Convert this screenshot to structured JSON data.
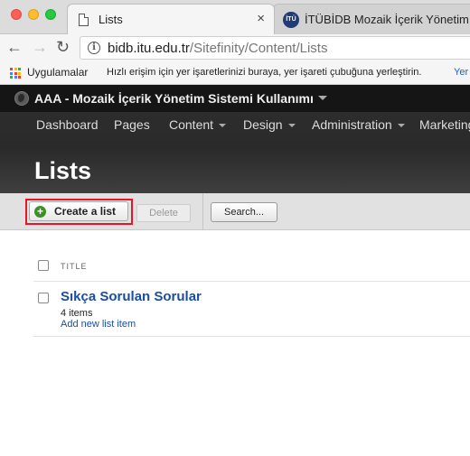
{
  "browser": {
    "tabs": [
      {
        "title": "Lists",
        "active": true
      },
      {
        "title": "İTÜBİDB Mozaik İçerik Yönetim",
        "active": false,
        "icon_text": "İTÜ"
      }
    ],
    "close_glyph": "×",
    "url_host": "bidb.itu.edu.tr",
    "url_path": "/Sitefinity/Content/Lists",
    "bookmarks": {
      "apps_label": "Uygulamalar",
      "hint": "Hızlı erişim için yer işaretlerinizi buraya, yer işareti çubuğuna yerleştirin.",
      "overflow": "Yer"
    }
  },
  "cms": {
    "site_name": "AAA - Mozaik İçerik Yönetim Sistemi Kullanımı",
    "nav": [
      {
        "label": "Dashboard",
        "dropdown": false
      },
      {
        "label": "Pages",
        "dropdown": false
      },
      {
        "label": "Content",
        "dropdown": true
      },
      {
        "label": "Design",
        "dropdown": true
      },
      {
        "label": "Administration",
        "dropdown": true
      },
      {
        "label": "Marketing",
        "dropdown": false
      }
    ],
    "page_title": "Lists"
  },
  "toolbar": {
    "create_label": "Create a list",
    "delete_label": "Delete",
    "search_label": "Search..."
  },
  "grid": {
    "column_title": "TITLE",
    "rows": [
      {
        "title": "Sıkça Sorulan Sorular",
        "count": "4 items",
        "action": "Add new list item"
      }
    ]
  },
  "colors": {
    "highlight": "#e8152a",
    "link": "#1c4da1",
    "add_icon": "#3f8f28"
  }
}
